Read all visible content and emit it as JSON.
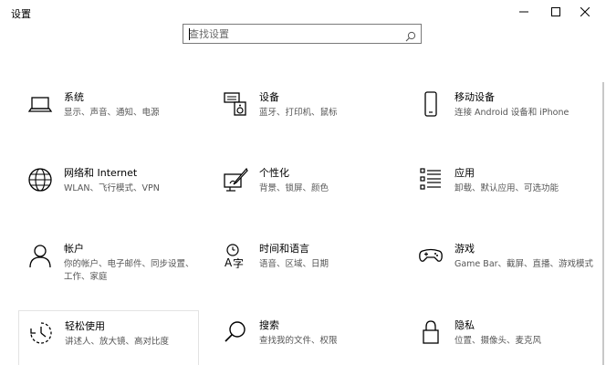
{
  "window": {
    "title": "设置"
  },
  "search": {
    "placeholder": "查找设置",
    "value": ""
  },
  "tiles": [
    {
      "name": "系统",
      "desc": "显示、声音、通知、电源",
      "icon": "laptop-icon"
    },
    {
      "name": "设备",
      "desc": "蓝牙、打印机、鼠标",
      "icon": "keyboard-speaker-icon"
    },
    {
      "name": "移动设备",
      "desc": "连接 Android 设备和 iPhone",
      "icon": "phone-icon"
    },
    {
      "name": "网络和 Internet",
      "desc": "WLAN、飞行模式、VPN",
      "icon": "globe-icon"
    },
    {
      "name": "个性化",
      "desc": "背景、锁屏、颜色",
      "icon": "paint-icon"
    },
    {
      "name": "应用",
      "desc": "卸载、默认应用、可选功能",
      "icon": "apps-list-icon"
    },
    {
      "name": "帐户",
      "desc": "你的帐户、电子邮件、同步设置、工作、家庭",
      "desc_line2": "工作、家庭",
      "icon": "person-icon"
    },
    {
      "name": "时间和语言",
      "desc": "语音、区域、日期",
      "icon": "time-language-icon"
    },
    {
      "name": "游戏",
      "desc": "Game Bar、截屏、直播、游戏模式",
      "icon": "gamepad-icon"
    },
    {
      "name": "轻松使用",
      "desc": "讲述人、放大镜、高对比度",
      "icon": "ease-of-access-icon"
    },
    {
      "name": "搜索",
      "desc": "查找我的文件、权限",
      "icon": "search-icon"
    },
    {
      "name": "隐私",
      "desc": "位置、摄像头、麦克风",
      "icon": "lock-icon"
    }
  ],
  "account_desc_lines": [
    "你的帐户、电子邮件、同步设置、",
    "工作、家庭"
  ]
}
